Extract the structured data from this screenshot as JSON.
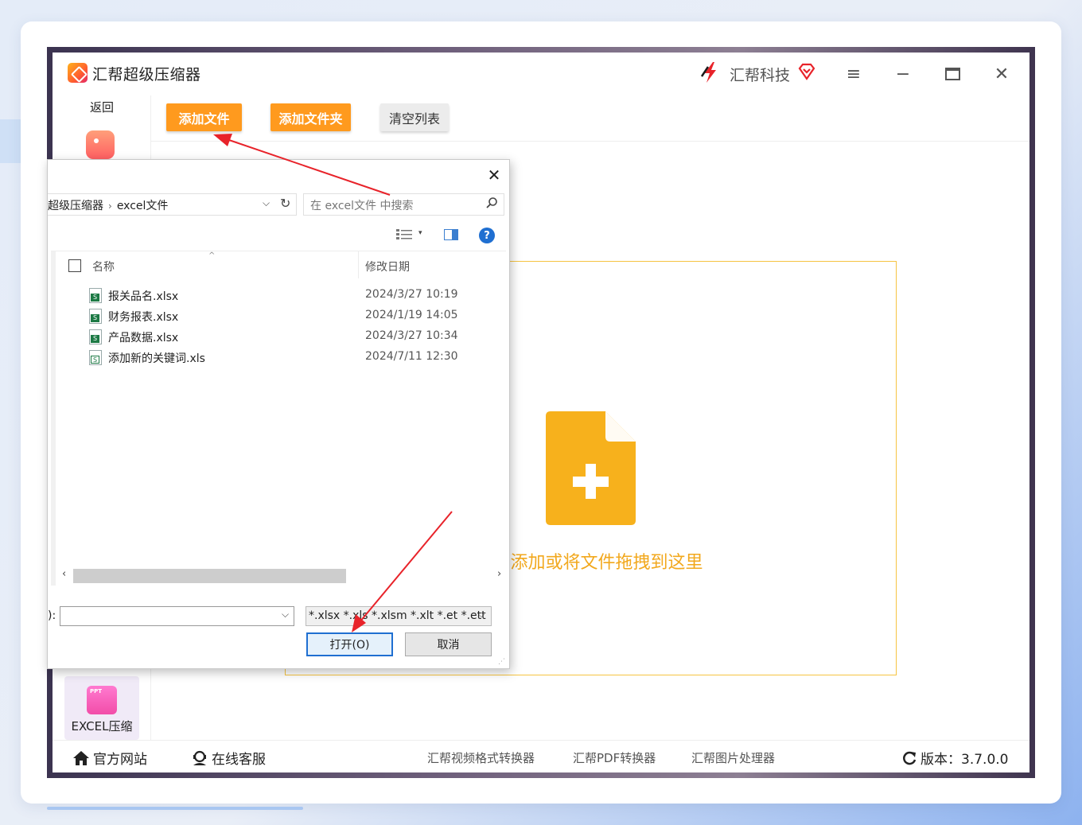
{
  "app": {
    "title": "汇帮超级压缩器",
    "brand": "汇帮科技"
  },
  "sidebar": {
    "back_label": "返回",
    "excel_tile_badge": "PPT",
    "excel_tile_label": "EXCEL压缩"
  },
  "toolbar": {
    "add_file": "添加文件",
    "add_folder": "添加文件夹",
    "clear_list": "清空列表"
  },
  "dropzone": {
    "text": "添加或将文件拖拽到这里"
  },
  "footer": {
    "website": "官方网站",
    "support": "在线客服",
    "links": [
      "汇帮视频格式转换器",
      "汇帮PDF转换器",
      "汇帮图片处理器"
    ],
    "version_label": "版本：3.7.0.0"
  },
  "dialog": {
    "path_parent": "超级压缩器",
    "path_current": "excel文件",
    "search_placeholder": "在 excel文件 中搜索",
    "col_name": "名称",
    "col_date": "修改日期",
    "files": [
      {
        "name": "报关品名.xlsx",
        "date": "2024/3/27 10:19"
      },
      {
        "name": "财务报表.xlsx",
        "date": "2024/1/19 14:05"
      },
      {
        "name": "产品数据.xlsx",
        "date": "2024/3/27 10:34"
      },
      {
        "name": "添加新的关键词.xls",
        "date": "2024/7/11 12:30"
      }
    ],
    "filename_label": "):",
    "filename_value": "",
    "filetype": "*.xlsx *.xls *.xlsm *.xlt *.et *.ett",
    "open_label": "打开(O)",
    "cancel_label": "取消",
    "help": "?"
  },
  "colors": {
    "accent": "#ff9a1e",
    "dropzone_border": "#f6c442",
    "dropzone_text": "#f2a81d",
    "arrow": "#e8232a"
  }
}
